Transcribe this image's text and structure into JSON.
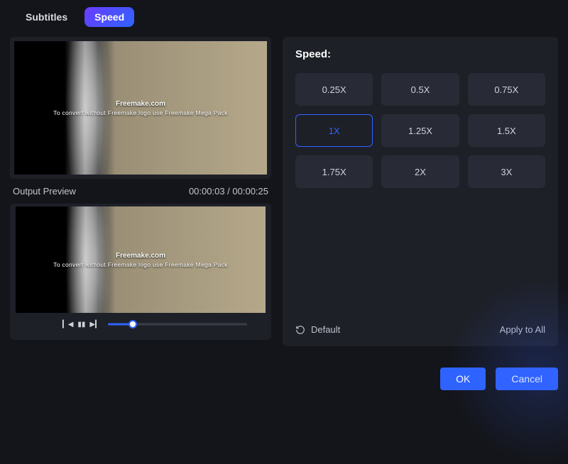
{
  "tabs": {
    "subtitles": "Subtitles",
    "speed": "Speed"
  },
  "preview": {
    "output_label": "Output Preview",
    "timecode": "00:00:03 / 00:00:25",
    "watermark_title": "Freemake.com",
    "watermark_sub": "To convert without Freemake logo use Freemake Mega Pack",
    "progress_pct": 18
  },
  "speed": {
    "title": "Speed:",
    "options": [
      "0.25X",
      "0.5X",
      "0.75X",
      "1X",
      "1.25X",
      "1.5X",
      "1.75X",
      "2X",
      "3X"
    ],
    "selected": "1X",
    "default_label": "Default",
    "apply_all_label": "Apply to All"
  },
  "buttons": {
    "ok": "OK",
    "cancel": "Cancel"
  }
}
